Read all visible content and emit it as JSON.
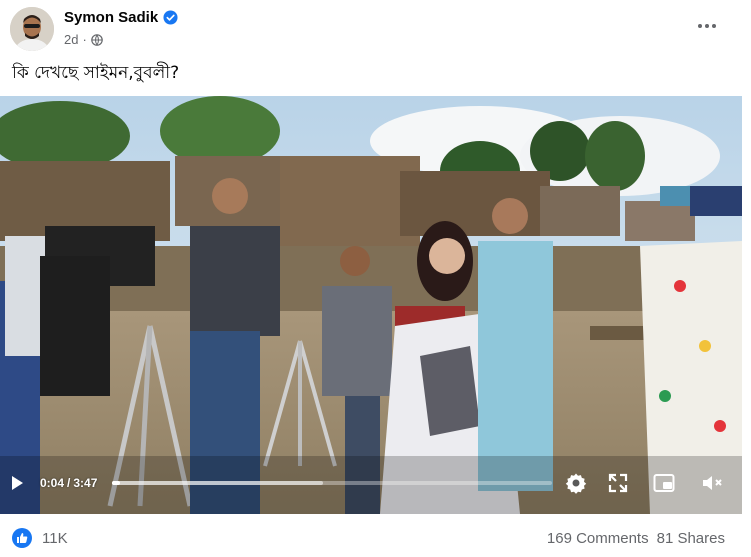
{
  "post": {
    "author": "Symon Sadik",
    "time": "2d",
    "caption": "কি দেখছে সাইমন,বুবলী?",
    "privacy_icon": "globe-icon",
    "verified_icon": "verified-badge-icon"
  },
  "video": {
    "current_time": "0:04",
    "separator": "/",
    "duration": "3:47",
    "progress_fraction": 0.018,
    "buffered_fraction": 0.48,
    "controls": [
      "play-icon",
      "settings-icon",
      "fullscreen-icon",
      "pip-icon",
      "volume-icon"
    ]
  },
  "engagement": {
    "reactions": "11K",
    "comments": "169 Comments",
    "shares": "81 Shares"
  },
  "colors": {
    "accent": "#1877f2",
    "secondary_text": "#65676b"
  }
}
